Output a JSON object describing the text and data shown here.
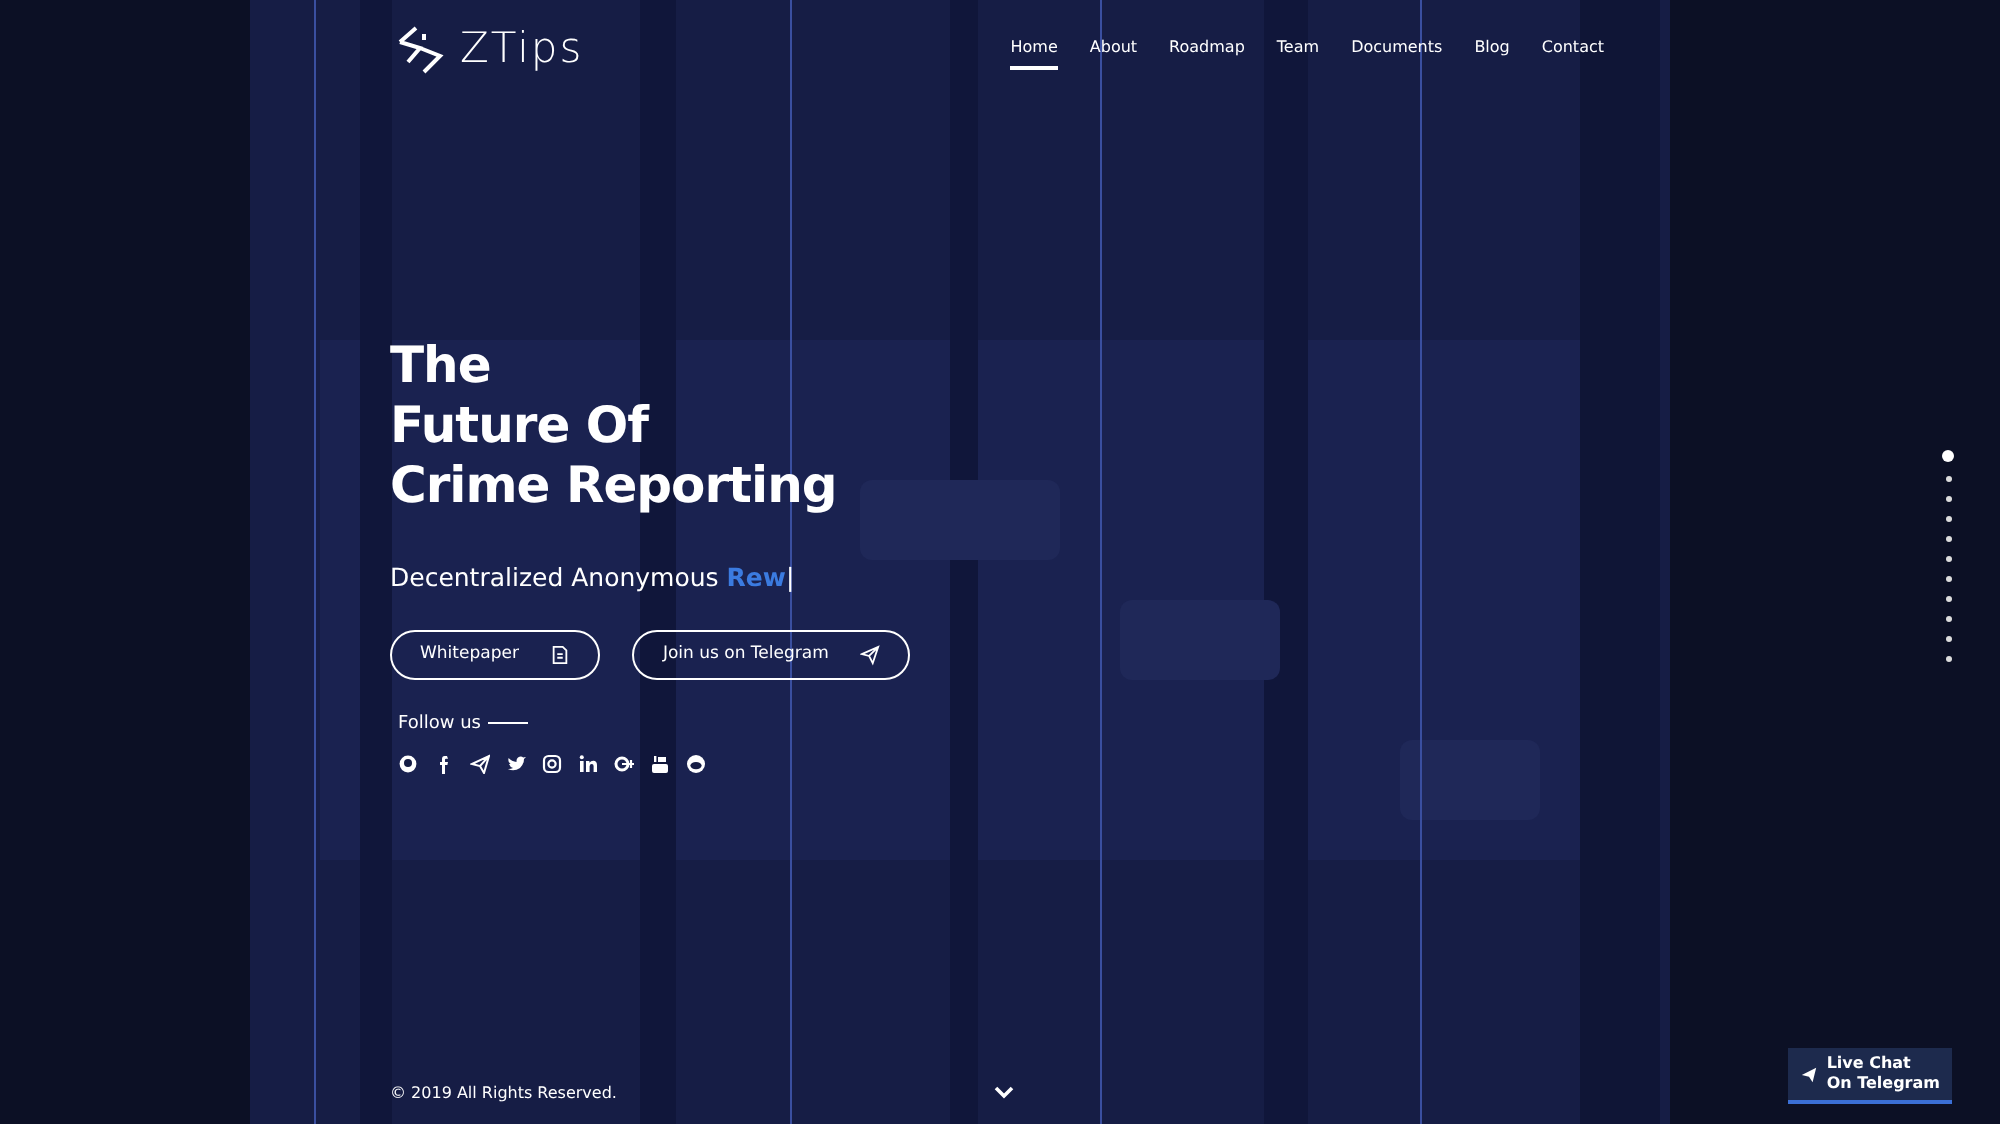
{
  "brand": {
    "name": "ZTips"
  },
  "nav": [
    {
      "label": "Home",
      "selected": true
    },
    {
      "label": "About",
      "selected": false
    },
    {
      "label": "Roadmap",
      "selected": false
    },
    {
      "label": "Team",
      "selected": false
    },
    {
      "label": "Documents",
      "selected": false
    },
    {
      "label": "Blog",
      "selected": false
    },
    {
      "label": "Contact",
      "selected": false
    }
  ],
  "hero": {
    "title_lines": [
      "The",
      "Future Of",
      "Crime Reporting"
    ],
    "subtitle": "Decentralized Anonymous",
    "typed": "Rew",
    "cursor": "|"
  },
  "buttons": [
    {
      "label": "Whitepaper",
      "kind": "document"
    },
    {
      "label": "Join us on Telegram",
      "kind": "telegram"
    }
  ],
  "follow": {
    "label": "Follow us"
  },
  "section_dots": [
    {
      "selected": true
    },
    {
      "selected": false
    },
    {
      "selected": false
    },
    {
      "selected": false
    },
    {
      "selected": false
    },
    {
      "selected": false
    },
    {
      "selected": false
    },
    {
      "selected": false
    },
    {
      "selected": false
    },
    {
      "selected": false
    },
    {
      "selected": false
    }
  ],
  "footer": {
    "copyright": "© 2019 All Rights Reserved."
  },
  "live_chat": {
    "line_1": "Live Chat",
    "line_2": "On Telegram"
  }
}
